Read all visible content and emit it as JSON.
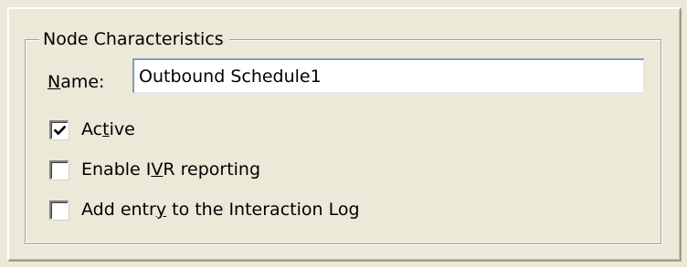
{
  "group": {
    "title": "Node Characteristics"
  },
  "name_field": {
    "label_mnemonic": "N",
    "label_rest": "ame:",
    "value": "Outbound Schedule1"
  },
  "checkboxes": [
    {
      "label_before": "Ac",
      "label_mnemonic": "t",
      "label_after": "ive",
      "checked": true
    },
    {
      "label_before": "Enable I",
      "label_mnemonic": "V",
      "label_after": "R reporting",
      "checked": false
    },
    {
      "label_before": "Add entr",
      "label_mnemonic": "y",
      "label_after": " to the Interaction Log",
      "checked": false
    }
  ],
  "colors": {
    "dialog_background": "#ece9d8",
    "input_border": "#7f9db9",
    "groupbox_border": "#a5a293"
  }
}
